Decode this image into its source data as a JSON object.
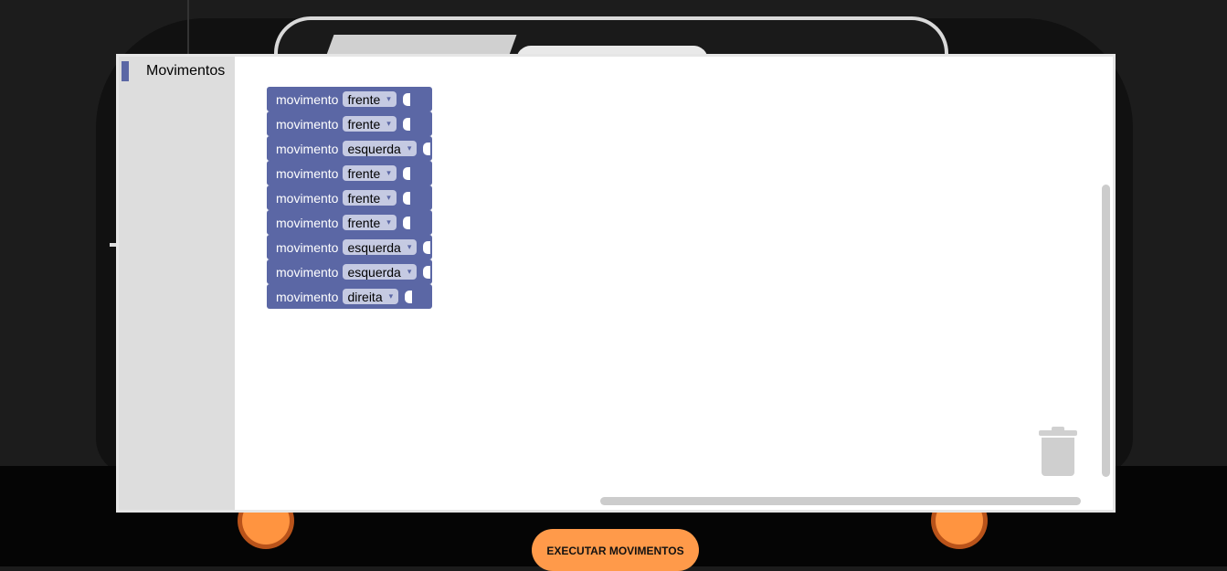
{
  "toolbox": {
    "category_label": "Movimentos",
    "category_color": "#5b67a5"
  },
  "workspace": {
    "blocks": [
      {
        "label": "movimento",
        "value": "frente"
      },
      {
        "label": "movimento",
        "value": "frente"
      },
      {
        "label": "movimento",
        "value": "esquerda"
      },
      {
        "label": "movimento",
        "value": "frente"
      },
      {
        "label": "movimento",
        "value": "frente"
      },
      {
        "label": "movimento",
        "value": "frente"
      },
      {
        "label": "movimento",
        "value": "esquerda"
      },
      {
        "label": "movimento",
        "value": "esquerda"
      },
      {
        "label": "movimento",
        "value": "direita"
      }
    ],
    "dropdown_arrow": "▾",
    "trash_icon": "trash-can-icon"
  },
  "actions": {
    "run_label": "EXECUTAR MOVIMENTOS",
    "run_color": "#ff9a4a"
  }
}
